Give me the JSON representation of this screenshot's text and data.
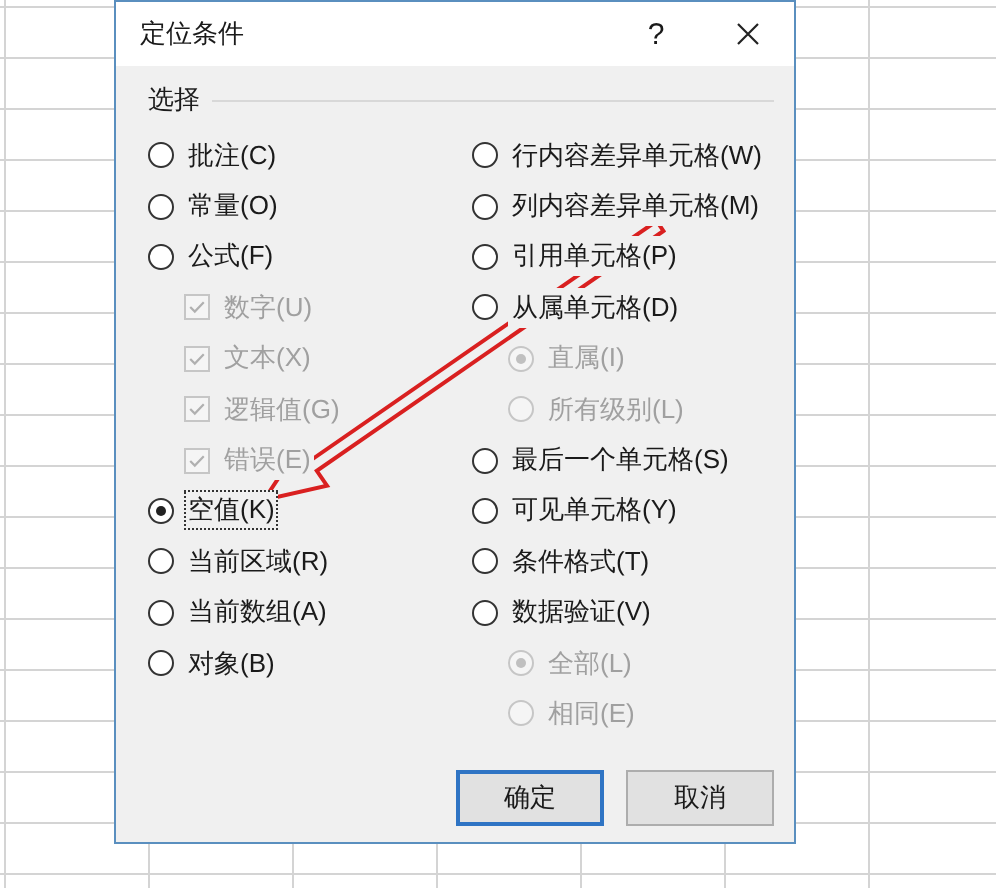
{
  "window": {
    "title": "定位条件",
    "help": "?"
  },
  "group": {
    "label": "选择"
  },
  "left_options": [
    {
      "kind": "radio",
      "label": "批注(C)",
      "selected": false,
      "focused": false,
      "disabled": false
    },
    {
      "kind": "radio",
      "label": "常量(O)",
      "selected": false,
      "focused": false,
      "disabled": false
    },
    {
      "kind": "radio",
      "label": "公式(F)",
      "selected": false,
      "focused": false,
      "disabled": false,
      "children": [
        {
          "kind": "checkbox",
          "label": "数字(U)",
          "checked": true,
          "disabled": true
        },
        {
          "kind": "checkbox",
          "label": "文本(X)",
          "checked": true,
          "disabled": true
        },
        {
          "kind": "checkbox",
          "label": "逻辑值(G)",
          "checked": true,
          "disabled": true
        },
        {
          "kind": "checkbox",
          "label": "错误(E)",
          "checked": true,
          "disabled": true
        }
      ]
    },
    {
      "kind": "radio",
      "label": "空值(K)",
      "selected": true,
      "focused": true,
      "disabled": false
    },
    {
      "kind": "radio",
      "label": "当前区域(R)",
      "selected": false,
      "focused": false,
      "disabled": false
    },
    {
      "kind": "radio",
      "label": "当前数组(A)",
      "selected": false,
      "focused": false,
      "disabled": false
    },
    {
      "kind": "radio",
      "label": "对象(B)",
      "selected": false,
      "focused": false,
      "disabled": false
    }
  ],
  "right_options": [
    {
      "kind": "radio",
      "label": "行内容差异单元格(W)",
      "selected": false,
      "focused": false,
      "disabled": false
    },
    {
      "kind": "radio",
      "label": "列内容差异单元格(M)",
      "selected": false,
      "focused": false,
      "disabled": false
    },
    {
      "kind": "radio",
      "label": "引用单元格(P)",
      "selected": false,
      "focused": false,
      "disabled": false
    },
    {
      "kind": "radio",
      "label": "从属单元格(D)",
      "selected": false,
      "focused": false,
      "disabled": false,
      "children": [
        {
          "kind": "radio",
          "label": "直属(I)",
          "selected": true,
          "disabled": true
        },
        {
          "kind": "radio",
          "label": "所有级别(L)",
          "selected": false,
          "disabled": true
        }
      ]
    },
    {
      "kind": "radio",
      "label": "最后一个单元格(S)",
      "selected": false,
      "focused": false,
      "disabled": false
    },
    {
      "kind": "radio",
      "label": "可见单元格(Y)",
      "selected": false,
      "focused": false,
      "disabled": false
    },
    {
      "kind": "radio",
      "label": "条件格式(T)",
      "selected": false,
      "focused": false,
      "disabled": false
    },
    {
      "kind": "radio",
      "label": "数据验证(V)",
      "selected": false,
      "focused": false,
      "disabled": false,
      "children": [
        {
          "kind": "radio",
          "label": "全部(L)",
          "selected": true,
          "disabled": true
        },
        {
          "kind": "radio",
          "label": "相同(E)",
          "selected": false,
          "disabled": true
        }
      ]
    }
  ],
  "buttons": [
    {
      "label": "确定",
      "default": true
    },
    {
      "label": "取消",
      "default": false
    }
  ]
}
